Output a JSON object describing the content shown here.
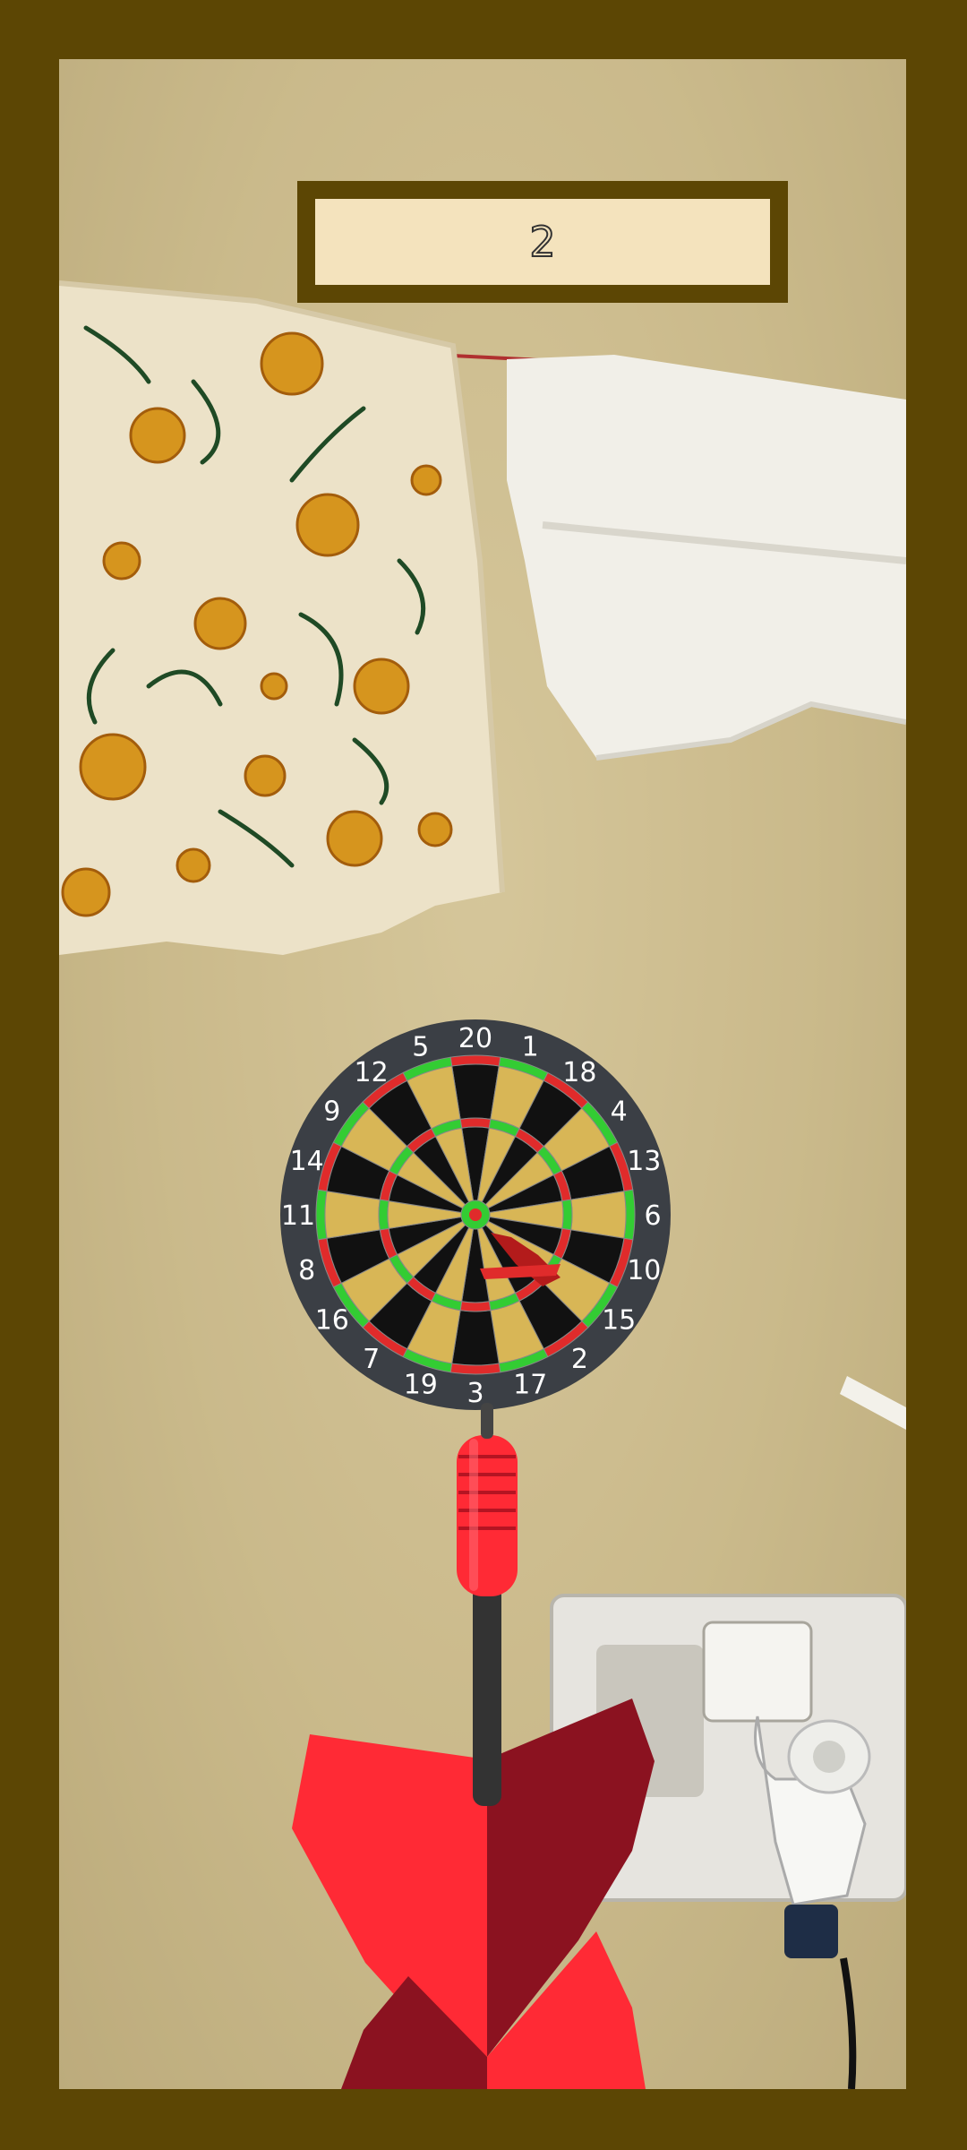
{
  "score": {
    "value": "2"
  },
  "dartboard": {
    "numbers": [
      "20",
      "1",
      "18",
      "4",
      "13",
      "6",
      "10",
      "15",
      "2",
      "17",
      "3",
      "19",
      "7",
      "16",
      "8",
      "11",
      "14",
      "9",
      "12",
      "5"
    ],
    "colors": {
      "surround": "#3b3f45",
      "dark_segment": "#111111",
      "light_segment": "#d8b656",
      "ring_red": "#e02b2b",
      "ring_green": "#33cc33",
      "number": "#ffffff"
    }
  },
  "dart": {
    "flight_color": "#ff2a35",
    "flight_shadow_color": "#8b1220",
    "barrel_color": "#ff2a35",
    "shaft_color": "#333333"
  },
  "frame": {
    "border_color": "#5c4604",
    "score_bg": "#f4e3bd"
  }
}
